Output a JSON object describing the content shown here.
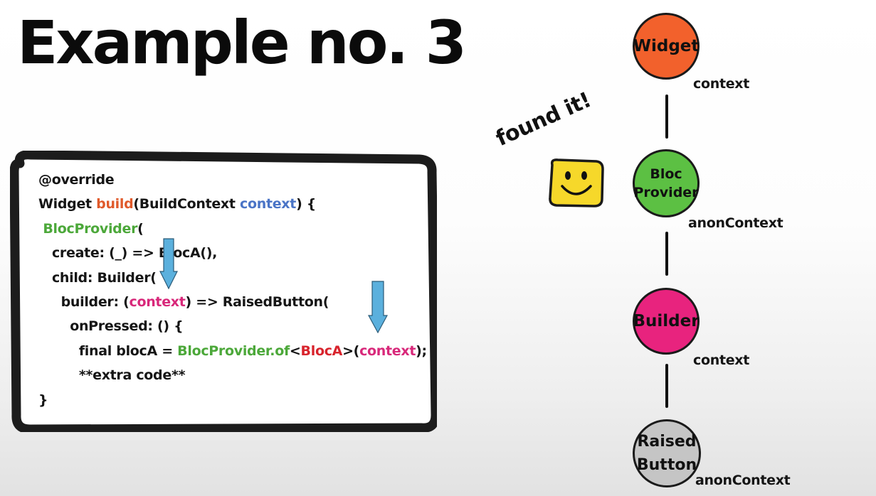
{
  "title": "Example no. 3",
  "code_lines": [
    [
      {
        "t": "@override",
        "c": ""
      }
    ],
    [
      {
        "t": "Widget ",
        "c": ""
      },
      {
        "t": "build",
        "c": "kw-orange"
      },
      {
        "t": "(BuildContext ",
        "c": ""
      },
      {
        "t": "context",
        "c": "kw-blue"
      },
      {
        "t": ") {",
        "c": ""
      }
    ],
    [
      {
        "t": " ",
        "c": ""
      },
      {
        "t": "BlocProvider",
        "c": "kw-green"
      },
      {
        "t": "(",
        "c": ""
      }
    ],
    [
      {
        "t": "   create: (_) => BlocA(),",
        "c": ""
      }
    ],
    [
      {
        "t": "   child: Builder(",
        "c": ""
      }
    ],
    [
      {
        "t": "     builder: (",
        "c": ""
      },
      {
        "t": "context",
        "c": "kw-pink"
      },
      {
        "t": ") => RaisedButton(",
        "c": ""
      }
    ],
    [
      {
        "t": "       onPressed: () {",
        "c": ""
      }
    ],
    [
      {
        "t": "         final blocA = ",
        "c": ""
      },
      {
        "t": "BlocProvider.of",
        "c": "kw-green"
      },
      {
        "t": "<",
        "c": ""
      },
      {
        "t": "BlocA",
        "c": "kw-red"
      },
      {
        "t": ">(",
        "c": ""
      },
      {
        "t": "context",
        "c": "kw-pink"
      },
      {
        "t": ");",
        "c": ""
      }
    ],
    [
      {
        "t": "         **extra code**",
        "c": ""
      }
    ],
    [
      {
        "t": "}",
        "c": ""
      }
    ]
  ],
  "found_label": "found it!",
  "nodes": [
    {
      "label": "Widget",
      "context": "context",
      "color": "#f2612c"
    },
    {
      "label": "Bloc\nProvider",
      "context": "anonContext",
      "color": "#5cc043"
    },
    {
      "label": "Builder",
      "context": "context",
      "color": "#e8237e"
    },
    {
      "label": "Raised\nButton",
      "context": "anonContext",
      "color": "#c5c5c5"
    }
  ],
  "colors": {
    "arrow": "#5bb0dd",
    "smiley": "#f6d82a"
  }
}
